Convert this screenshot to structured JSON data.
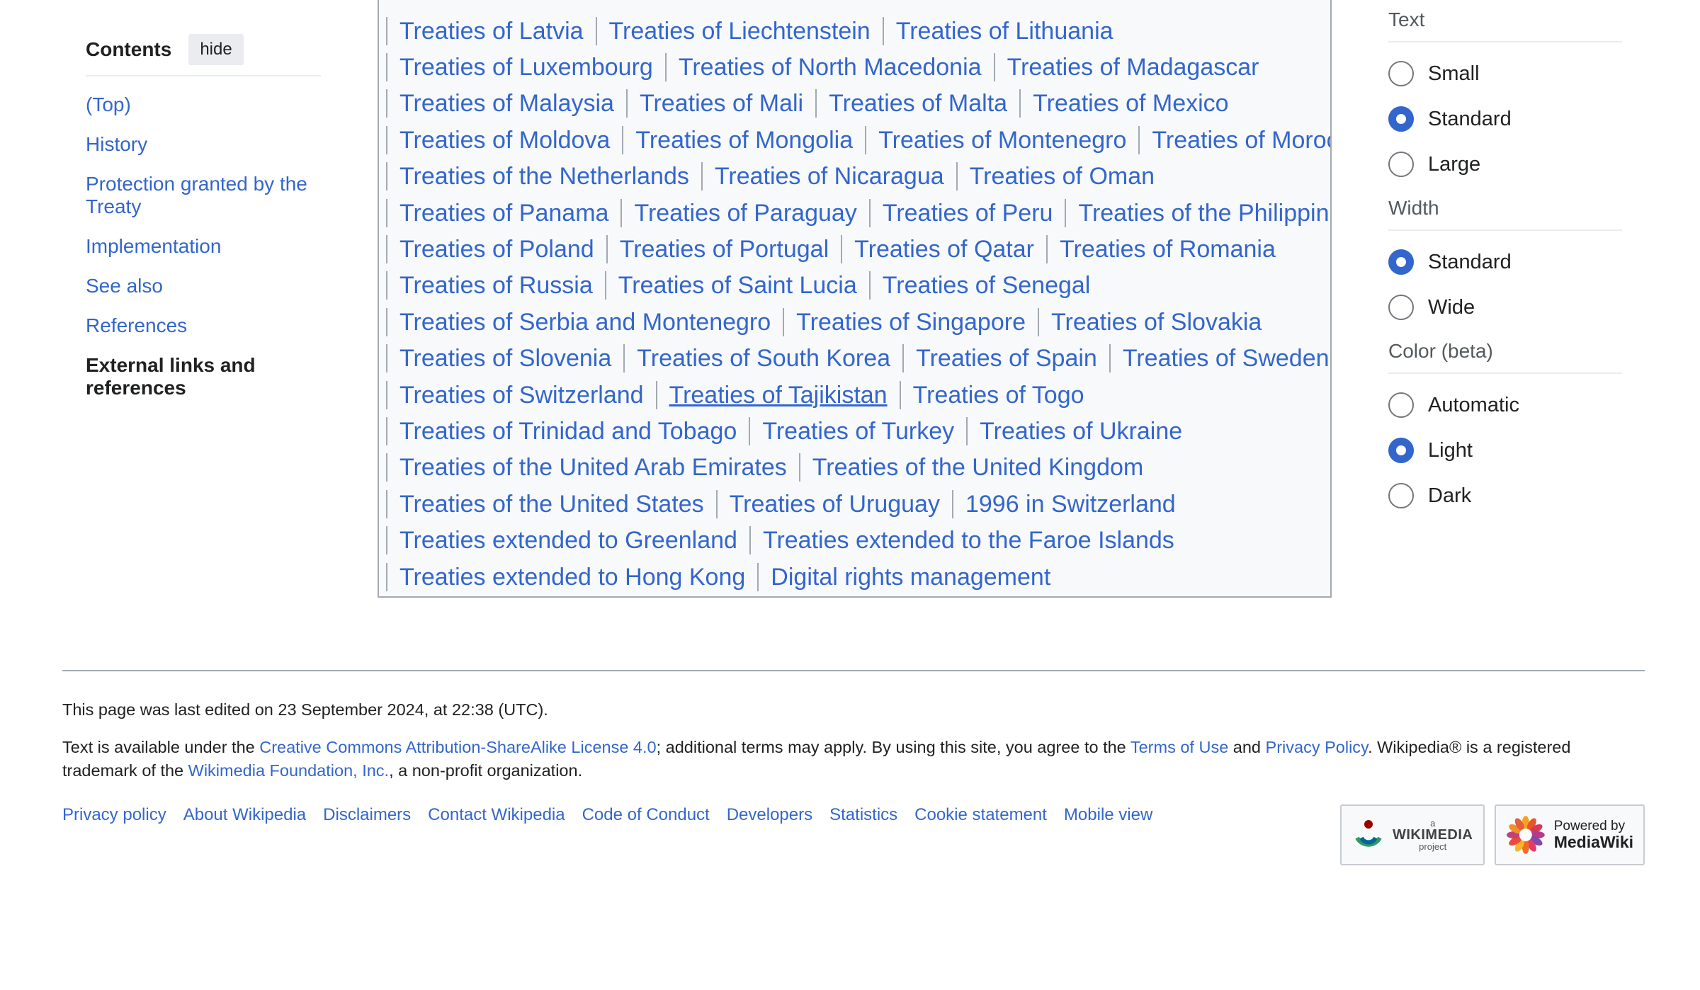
{
  "toc": {
    "title": "Contents",
    "hide_label": "hide",
    "items": [
      {
        "label": "(Top)"
      },
      {
        "label": "History"
      },
      {
        "label": "Protection granted by the Treaty"
      },
      {
        "label": "Implementation"
      },
      {
        "label": "See also"
      },
      {
        "label": "References"
      },
      {
        "label": "External links and references"
      }
    ]
  },
  "categories": {
    "rows": [
      [
        "Treaties of Latvia",
        "Treaties of Liechtenstein",
        "Treaties of Lithuania"
      ],
      [
        "Treaties of Luxembourg",
        "Treaties of North Macedonia",
        "Treaties of Madagascar"
      ],
      [
        "Treaties of Malaysia",
        "Treaties of Mali",
        "Treaties of Malta",
        "Treaties of Mexico"
      ],
      [
        "Treaties of Moldova",
        "Treaties of Mongolia",
        "Treaties of Montenegro",
        "Treaties of Morocco"
      ],
      [
        "Treaties of the Netherlands",
        "Treaties of Nicaragua",
        "Treaties of Oman"
      ],
      [
        "Treaties of Panama",
        "Treaties of Paraguay",
        "Treaties of Peru",
        "Treaties of the Philippines"
      ],
      [
        "Treaties of Poland",
        "Treaties of Portugal",
        "Treaties of Qatar",
        "Treaties of Romania"
      ],
      [
        "Treaties of Russia",
        "Treaties of Saint Lucia",
        "Treaties of Senegal"
      ],
      [
        "Treaties of Serbia and Montenegro",
        "Treaties of Singapore",
        "Treaties of Slovakia"
      ],
      [
        "Treaties of Slovenia",
        "Treaties of South Korea",
        "Treaties of Spain",
        "Treaties of Sweden"
      ],
      [
        "Treaties of Switzerland",
        "Treaties of Tajikistan",
        "Treaties of Togo"
      ],
      [
        "Treaties of Trinidad and Tobago",
        "Treaties of Turkey",
        "Treaties of Ukraine"
      ],
      [
        "Treaties of the United Arab Emirates",
        "Treaties of the United Kingdom"
      ],
      [
        "Treaties of the United States",
        "Treaties of Uruguay",
        "1996 in Switzerland"
      ],
      [
        "Treaties extended to Greenland",
        "Treaties extended to the Faroe Islands"
      ],
      [
        "Treaties extended to Hong Kong",
        "Digital rights management"
      ]
    ],
    "hovered": "Treaties of Tajikistan"
  },
  "appearance": {
    "groups": [
      {
        "title": "Text",
        "options": [
          {
            "label": "Small",
            "checked": false
          },
          {
            "label": "Standard",
            "checked": true
          },
          {
            "label": "Large",
            "checked": false
          }
        ]
      },
      {
        "title": "Width",
        "options": [
          {
            "label": "Standard",
            "checked": true
          },
          {
            "label": "Wide",
            "checked": false
          }
        ]
      },
      {
        "title": "Color (beta)",
        "options": [
          {
            "label": "Automatic",
            "checked": false
          },
          {
            "label": "Light",
            "checked": true
          },
          {
            "label": "Dark",
            "checked": false
          }
        ]
      }
    ]
  },
  "footer": {
    "last_edited": "This page was last edited on 23 September 2024, at 22:38 (UTC).",
    "license": {
      "t1": "Text is available under the ",
      "cc_link": "Creative Commons Attribution-ShareAlike License 4.0",
      "t2": "; additional terms may apply. By using this site, you agree to the ",
      "terms_link": "Terms of Use",
      "t3": " and ",
      "privacy_link": "Privacy Policy",
      "t4": ". Wikipedia® is a registered trademark of the ",
      "wmf_link": "Wikimedia Foundation, Inc.",
      "t5": ", a non-profit organization."
    },
    "links": [
      "Privacy policy",
      "About Wikipedia",
      "Disclaimers",
      "Contact Wikipedia",
      "Code of Conduct",
      "Developers",
      "Statistics",
      "Cookie statement",
      "Mobile view"
    ],
    "wikimedia_badge": {
      "small": "a",
      "big": "WIKIMEDIA",
      "sub": "project"
    },
    "mediawiki_badge": {
      "small": "Powered by",
      "big": "MediaWiki"
    }
  },
  "colors": {
    "link": "#3366cc",
    "box_border": "#a2a9b1",
    "box_background": "#f8f9fa",
    "radio_checked": "#3366cc"
  }
}
